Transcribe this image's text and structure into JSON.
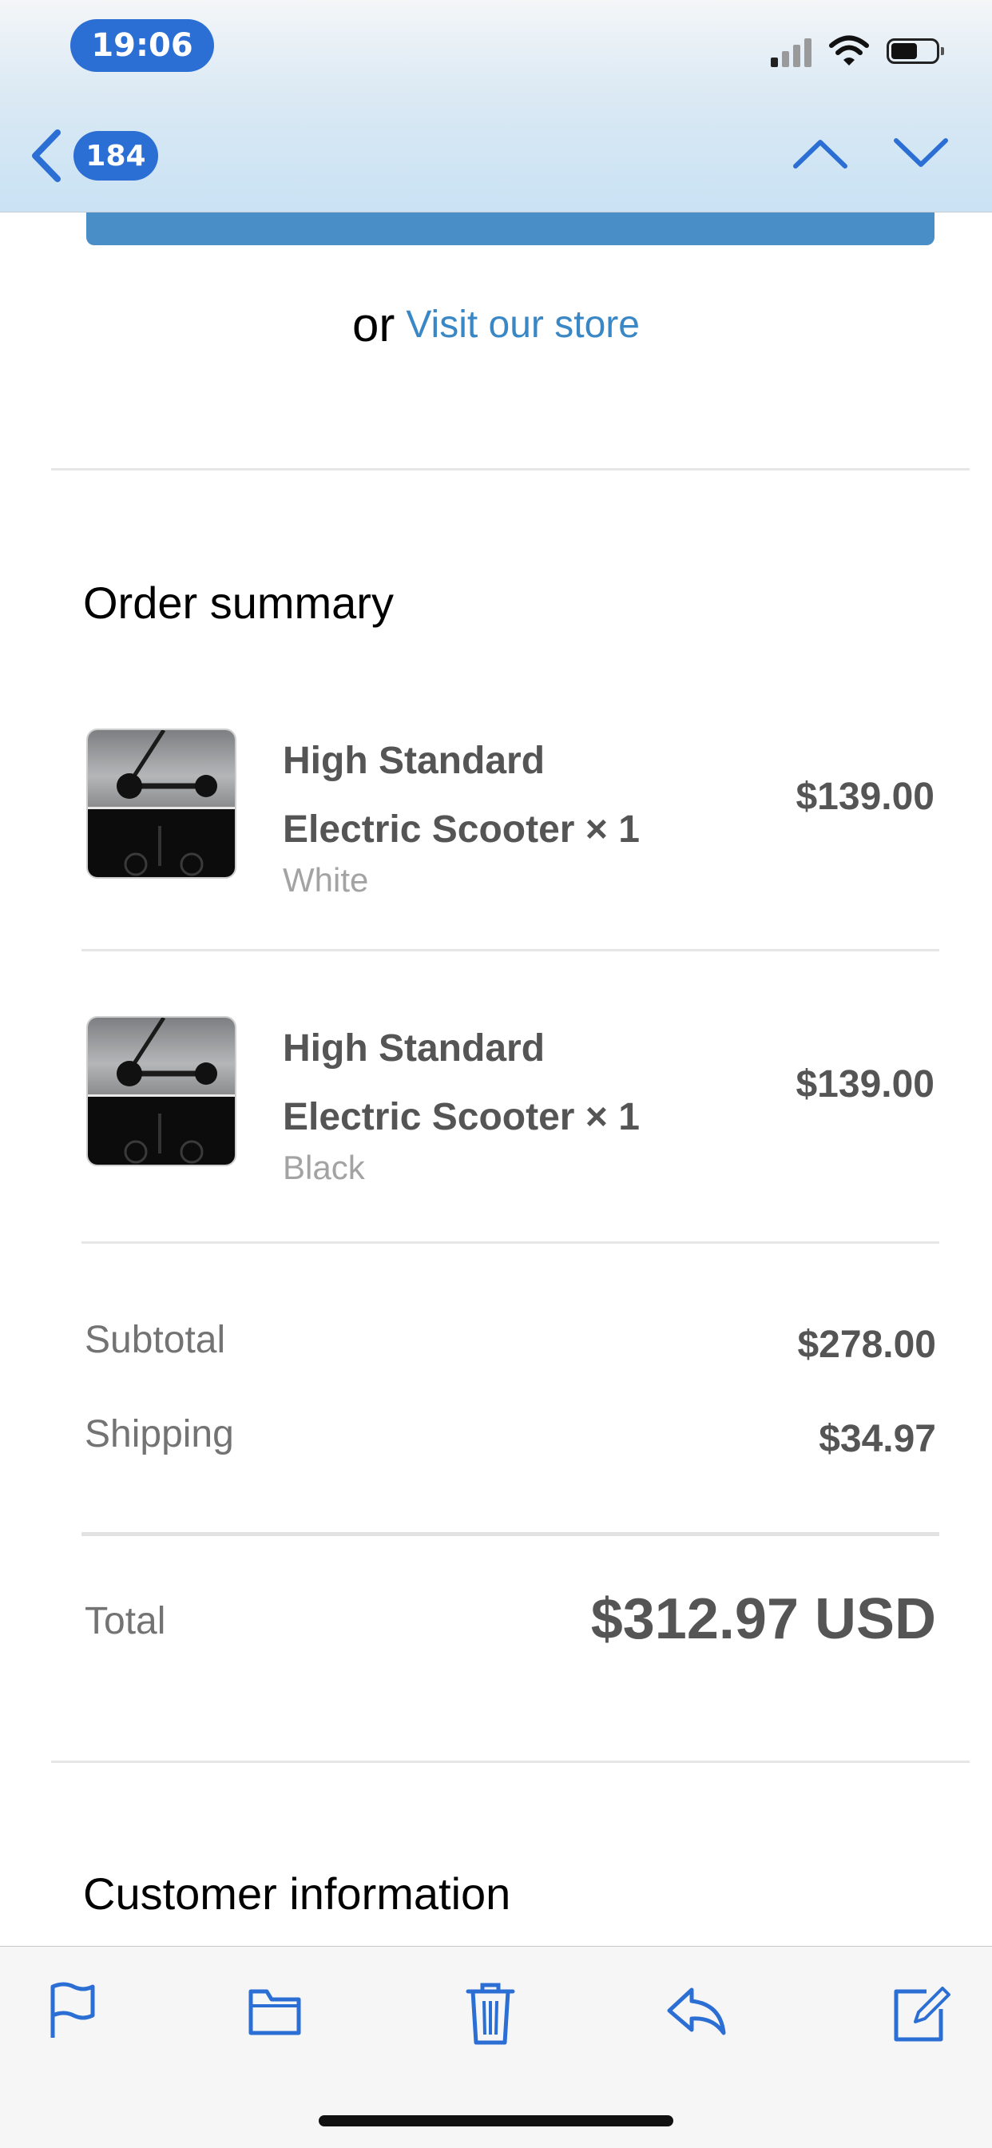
{
  "status_bar": {
    "time": "19:06",
    "icons": [
      "cellular-signal-icon",
      "wifi-icon",
      "battery-icon"
    ]
  },
  "nav": {
    "back_count": "184",
    "icons": [
      "chevron-left-icon",
      "chevron-up-icon",
      "chevron-down-icon"
    ]
  },
  "email": {
    "store_prefix": "or",
    "store_link": "Visit our store",
    "order_summary_title": "Order summary",
    "items": [
      {
        "name_line1": "High Standard",
        "name_line2": "Electric Scooter × 1",
        "variant": "White",
        "price": "$139.00"
      },
      {
        "name_line1": "High Standard",
        "name_line2": "Electric Scooter × 1",
        "variant": "Black",
        "price": "$139.00"
      }
    ],
    "subtotal_label": "Subtotal",
    "subtotal_value": "$278.00",
    "shipping_label": "Shipping",
    "shipping_value": "$34.97",
    "total_label": "Total",
    "total_value": "$312.97 USD",
    "customer_info_title": "Customer information"
  },
  "toolbar": {
    "icons": [
      "flag-icon",
      "folder-icon",
      "trash-icon",
      "reply-icon",
      "compose-icon"
    ]
  },
  "colors": {
    "accent": "#2c6fd4",
    "link": "#3a87c6",
    "cta": "#4a8ec7"
  }
}
